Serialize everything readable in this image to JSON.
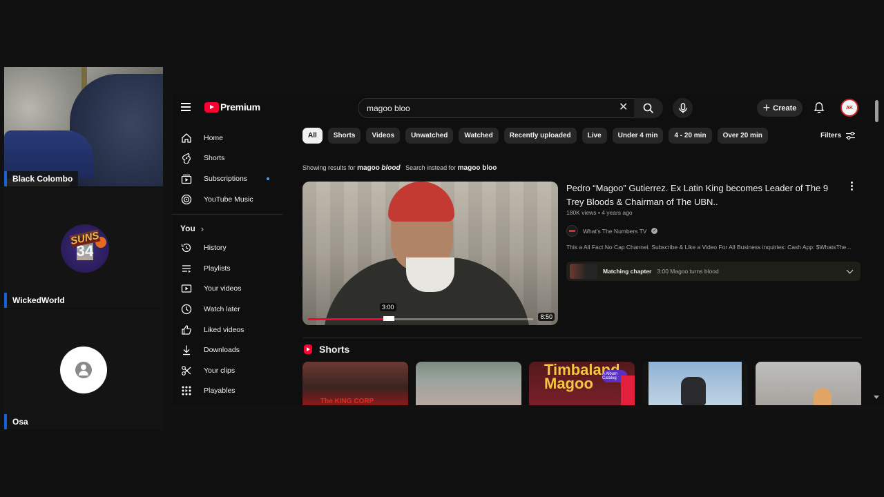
{
  "participants": [
    {
      "name": "Black Colombo"
    },
    {
      "name": "WickedWorld",
      "avatar_text_top": "SUNS",
      "avatar_text_bottom": "34"
    },
    {
      "name": "Osa"
    }
  ],
  "youtube": {
    "brand": "Premium",
    "search_value": "magoo bloo",
    "create_label": "Create",
    "account_badge": "AK",
    "sidebar": {
      "main": [
        {
          "label": "Home",
          "icon": "home-icon"
        },
        {
          "label": "Shorts",
          "icon": "shorts-icon"
        },
        {
          "label": "Subscriptions",
          "icon": "subscriptions-icon",
          "has_dot": true
        },
        {
          "label": "YouTube Music",
          "icon": "music-icon"
        }
      ],
      "you_label": "You",
      "you_items": [
        {
          "label": "History",
          "icon": "history-icon"
        },
        {
          "label": "Playlists",
          "icon": "playlists-icon"
        },
        {
          "label": "Your videos",
          "icon": "your-videos-icon"
        },
        {
          "label": "Watch later",
          "icon": "watch-later-icon"
        },
        {
          "label": "Liked videos",
          "icon": "thumbs-up-icon"
        },
        {
          "label": "Downloads",
          "icon": "download-icon"
        },
        {
          "label": "Your clips",
          "icon": "scissors-icon"
        },
        {
          "label": "Playables",
          "icon": "playables-icon"
        }
      ]
    },
    "chips": [
      "All",
      "Shorts",
      "Videos",
      "Unwatched",
      "Watched",
      "Recently uploaded",
      "Live",
      "Under 4 min",
      "4 - 20 min",
      "Over 20 min"
    ],
    "active_chip": "All",
    "filters_label": "Filters",
    "correction": {
      "showing_prefix": "Showing results for",
      "corrected_plain": "magoo",
      "corrected_italic": "blood",
      "instead_prefix": "Search instead for",
      "original": "magoo bloo"
    },
    "result": {
      "title": "Pedro “Magoo” Gutierrez. Ex Latin King becomes Leader of The 9 Trey Bloods & Chairman of The UBN..",
      "meta": "180K views • 4 years ago",
      "channel": "What's The Numbers TV",
      "description": "This a All Fact No Cap Channel. Subscribe & Like a Video For All Business inquiries: Cash App: $WhatsThe...",
      "preview_time": "3:00",
      "duration": "8:50",
      "progress_fraction": 0.36,
      "chapter_label": "Matching chapter",
      "chapter_text": "3:00 Magoo turns blood"
    },
    "shorts_heading": "Shorts",
    "shorts_thumb_texts": [
      "The KING CORP",
      "",
      "Timbaland Magoo",
      "",
      ""
    ],
    "shorts_badge": "A Album Catalog"
  }
}
